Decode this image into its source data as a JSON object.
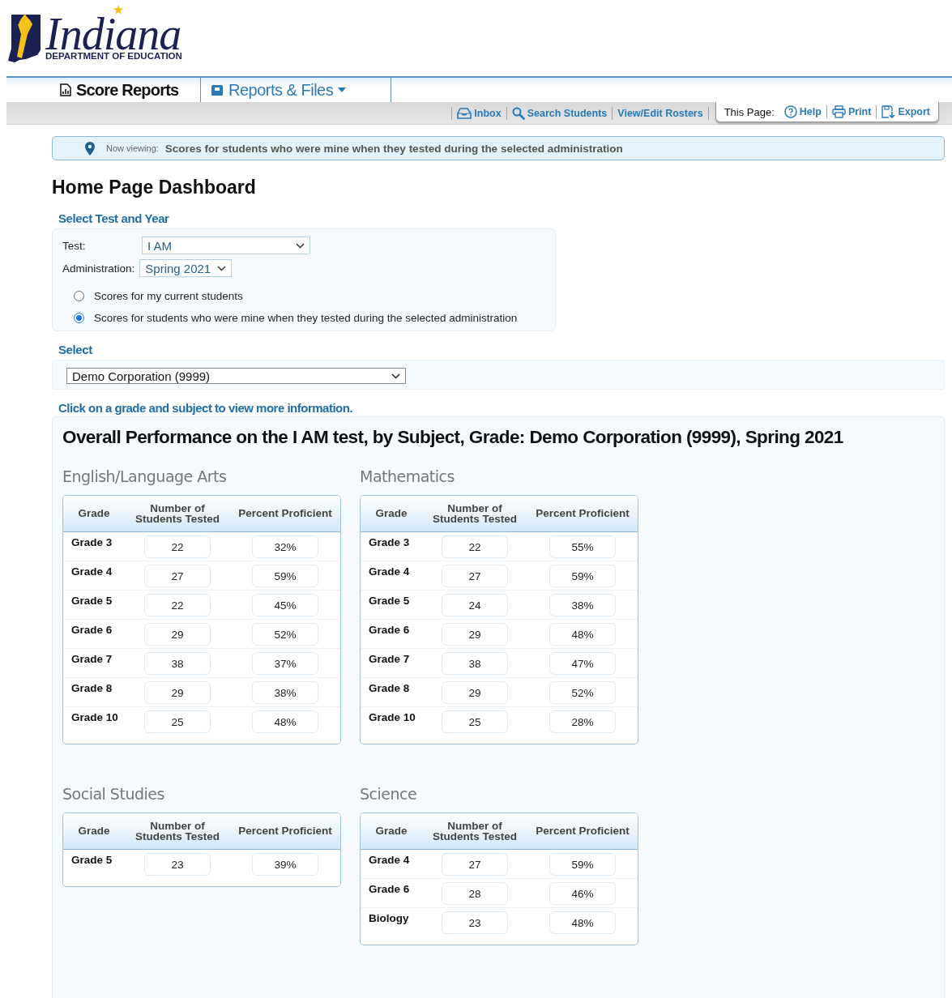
{
  "logo": {
    "name": "Indiana",
    "subtitle": "DEPARTMENT OF EDUCATION"
  },
  "tabs": [
    {
      "label": "Score Reports",
      "selected": true,
      "kind": "report"
    },
    {
      "label": "Reports & Files",
      "selected": false,
      "kind": "files"
    }
  ],
  "toolbar": {
    "links": [
      {
        "label": "Inbox",
        "kind": "inbox"
      },
      {
        "label": "Search Students",
        "kind": "search"
      },
      {
        "label": "View/Edit Rosters",
        "kind": "none"
      }
    ],
    "this_page": {
      "label": "This Page:",
      "links": [
        {
          "label": "Help",
          "kind": "help"
        },
        {
          "label": "Print",
          "kind": "print"
        },
        {
          "label": "Export",
          "kind": "export"
        }
      ]
    }
  },
  "notice": {
    "label": "Now viewing:",
    "text": "Scores for students who were mine when they tested during the selected administration"
  },
  "title": "Home Page Dashboard",
  "test_section": {
    "heading": "Select Test and Year",
    "fields": [
      {
        "label": "Test:",
        "value": "I AM",
        "kind": "wide"
      },
      {
        "label": "Administration:",
        "value": "Spring 2021",
        "kind": "narrow"
      }
    ],
    "options": [
      {
        "label": "Scores for my current students",
        "selected": false
      },
      {
        "label": "Scores for students who were mine when they tested during the selected administration",
        "selected": true
      }
    ]
  },
  "select_section": {
    "heading": "Select",
    "value": "Demo Corporation (9999)"
  },
  "instruction": "Click on a grade and subject to view more information.",
  "overview": {
    "title": "Overall Performance on the I AM test, by Subject, Grade: Demo Corporation (9999), Spring 2021",
    "subjects": [
      {
        "name": "English/Language Arts",
        "columns": [
          "Grade",
          "Number of Students Tested",
          "Percent Proficient"
        ],
        "rows": [
          {
            "grade": "Grade 3",
            "tested": "22",
            "proficient": "32%"
          },
          {
            "grade": "Grade 4",
            "tested": "27",
            "proficient": "59%"
          },
          {
            "grade": "Grade 5",
            "tested": "22",
            "proficient": "45%"
          },
          {
            "grade": "Grade 6",
            "tested": "29",
            "proficient": "52%"
          },
          {
            "grade": "Grade 7",
            "tested": "38",
            "proficient": "37%"
          },
          {
            "grade": "Grade 8",
            "tested": "29",
            "proficient": "38%"
          },
          {
            "grade": "Grade 10",
            "tested": "25",
            "proficient": "48%"
          }
        ]
      },
      {
        "name": "Mathematics",
        "columns": [
          "Grade",
          "Number of Students Tested",
          "Percent Proficient"
        ],
        "rows": [
          {
            "grade": "Grade 3",
            "tested": "22",
            "proficient": "55%"
          },
          {
            "grade": "Grade 4",
            "tested": "27",
            "proficient": "59%"
          },
          {
            "grade": "Grade 5",
            "tested": "24",
            "proficient": "38%"
          },
          {
            "grade": "Grade 6",
            "tested": "29",
            "proficient": "48%"
          },
          {
            "grade": "Grade 7",
            "tested": "38",
            "proficient": "47%"
          },
          {
            "grade": "Grade 8",
            "tested": "29",
            "proficient": "52%"
          },
          {
            "grade": "Grade 10",
            "tested": "25",
            "proficient": "28%"
          }
        ]
      },
      {
        "name": "Social Studies",
        "columns": [
          "Grade",
          "Number of Students Tested",
          "Percent Proficient"
        ],
        "rows": [
          {
            "grade": "Grade 5",
            "tested": "23",
            "proficient": "39%"
          }
        ]
      },
      {
        "name": "Science",
        "columns": [
          "Grade",
          "Number of Students Tested",
          "Percent Proficient"
        ],
        "rows": [
          {
            "grade": "Grade 4",
            "tested": "27",
            "proficient": "59%"
          },
          {
            "grade": "Grade 6",
            "tested": "28",
            "proficient": "46%"
          },
          {
            "grade": "Biology",
            "tested": "23",
            "proficient": "48%"
          }
        ]
      }
    ]
  }
}
